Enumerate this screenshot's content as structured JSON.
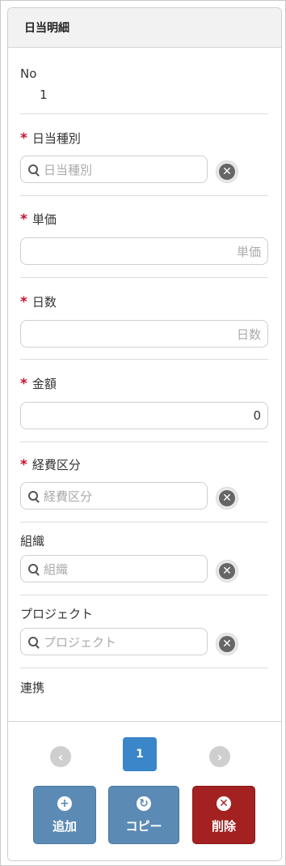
{
  "panel": {
    "title": "日当明細"
  },
  "no": {
    "label": "No",
    "value": "1"
  },
  "allowance_type": {
    "label": "日当種別",
    "placeholder": "日当種別"
  },
  "unit_price": {
    "label": "単価",
    "placeholder": "単価"
  },
  "days": {
    "label": "日数",
    "placeholder": "日数"
  },
  "amount": {
    "label": "金額",
    "value": "0"
  },
  "expense_category": {
    "label": "経費区分",
    "placeholder": "経費区分"
  },
  "organization": {
    "label": "組織",
    "placeholder": "組織"
  },
  "project": {
    "label": "プロジェクト",
    "placeholder": "プロジェクト"
  },
  "link": {
    "label": "連携"
  },
  "required_mark": "*",
  "pagination": {
    "current_page": "1",
    "prev_icon": "chevron-left-icon",
    "next_icon": "chevron-right-icon"
  },
  "actions": {
    "add_label": "追加",
    "copy_label": "コピー",
    "delete_label": "削除"
  },
  "colors": {
    "primary": "#3a86c8",
    "action_blue": "#5b8ab5",
    "danger": "#a32121",
    "required": "#c8102e"
  }
}
